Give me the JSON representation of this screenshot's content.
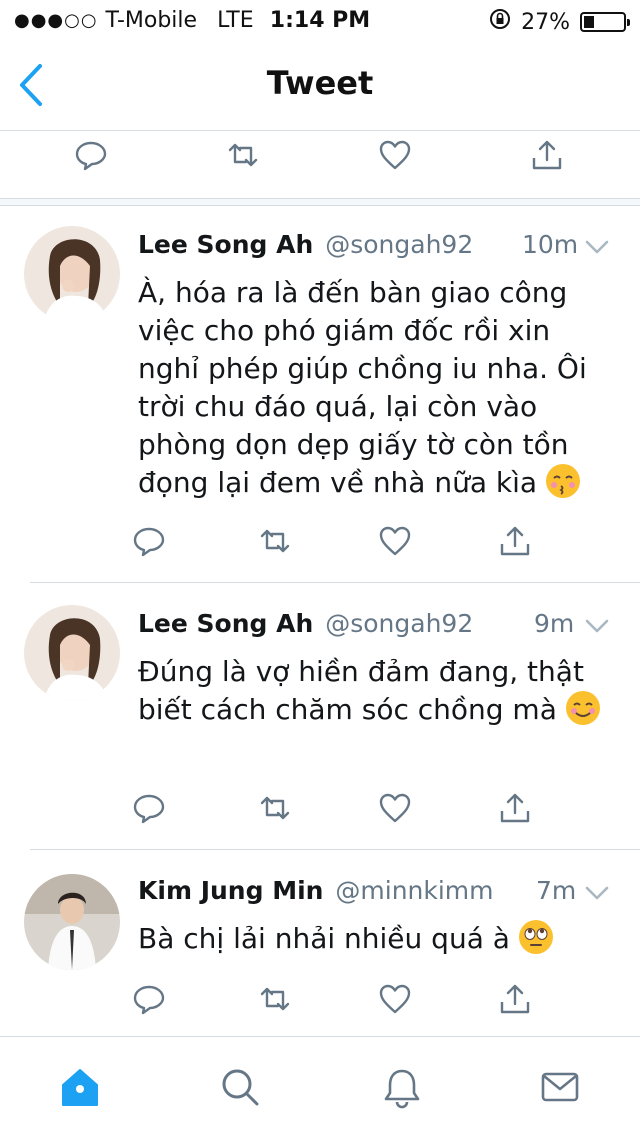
{
  "status_bar": {
    "signal": "●●●○○",
    "carrier": "T-Mobile",
    "network": "LTE",
    "time": "1:14 PM",
    "battery": "27%"
  },
  "nav": {
    "title": "Tweet",
    "accent": "#1da1f2"
  },
  "tweets": [
    {
      "name": "Lee Song Ah",
      "handle": "@songah92",
      "time": "10m",
      "text": "À, hóa ra là đến bàn giao công việc cho phó giám đốc rồi xin nghỉ phép giúp chồng iu nha. Ôi trời chu đáo quá, lại còn vào phòng dọn dẹp giấy tờ còn tồn đọng lại đem về nhà nữa kìa",
      "emoji": "kissing-face"
    },
    {
      "name": "Lee Song Ah",
      "handle": "@songah92",
      "time": "9m",
      "text": "Đúng là vợ hiền đảm đang, thật biết cách chăm sóc chồng mà",
      "emoji": "smiling-face"
    },
    {
      "name": "Kim Jung Min",
      "handle": "@minnkimm",
      "time": "7m",
      "text": "Bà chị lải nhải nhiều quá à",
      "emoji": "eye-roll-face"
    }
  ],
  "action_icons": [
    "reply-icon",
    "retweet-icon",
    "like-icon",
    "share-icon"
  ],
  "tab_icons": [
    "home-icon",
    "search-icon",
    "notifications-icon",
    "messages-icon"
  ]
}
